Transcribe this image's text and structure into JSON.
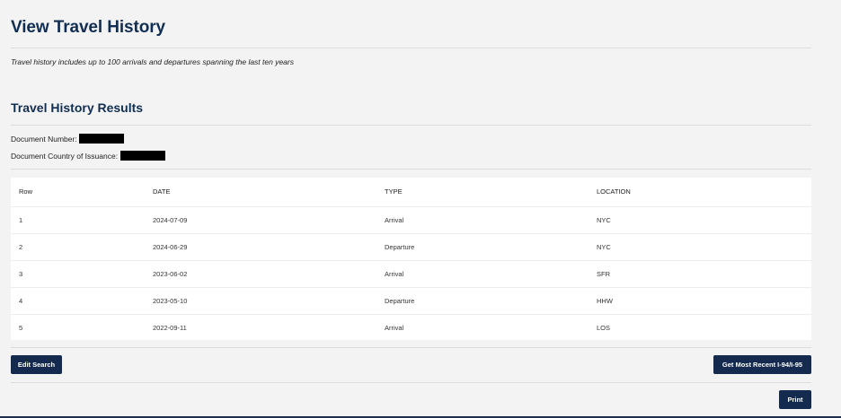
{
  "page_title": "View Travel History",
  "intro_text": "Travel history includes up to 100 arrivals and departures spanning the last ten years",
  "results_title": "Travel History Results",
  "document_number_label": "Document Number:",
  "document_country_label": "Document Country of Issuance:",
  "table": {
    "headers": {
      "row": "Row",
      "date": "DATE",
      "type": "TYPE",
      "location": "LOCATION"
    },
    "rows": [
      {
        "row": "1",
        "date": "2024-07-09",
        "type": "Arrival",
        "location": "NYC"
      },
      {
        "row": "2",
        "date": "2024-06-29",
        "type": "Departure",
        "location": "NYC"
      },
      {
        "row": "3",
        "date": "2023-06-02",
        "type": "Arrival",
        "location": "SFR"
      },
      {
        "row": "4",
        "date": "2023-05-10",
        "type": "Departure",
        "location": "HHW"
      },
      {
        "row": "5",
        "date": "2022-09-11",
        "type": "Arrival",
        "location": "LOS"
      }
    ]
  },
  "buttons": {
    "edit_search": "Edit Search",
    "get_recent": "Get Most Recent I-94/I-95",
    "print": "Print"
  },
  "colors": {
    "heading": "#112e51",
    "button": "#142a4e",
    "background": "#f3f3f3"
  }
}
